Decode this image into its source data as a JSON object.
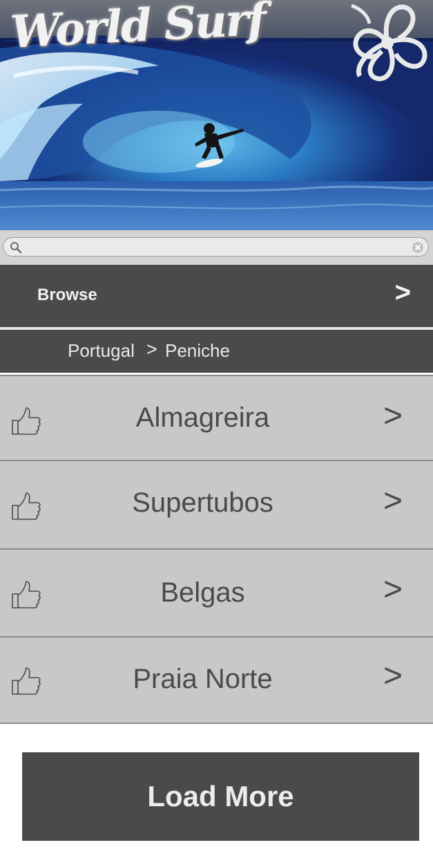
{
  "header": {
    "logo_text": "World Surf",
    "banner_image": "surfer-in-barrel-wave",
    "decoration_icon": "hibiscus-flower-icon"
  },
  "search": {
    "placeholder": "",
    "value": "",
    "search_icon": "search-icon",
    "clear_icon": "clear-icon"
  },
  "browse": {
    "label": "Browse",
    "arrow": ">"
  },
  "breadcrumb": {
    "items": [
      "Portugal",
      "Peniche"
    ],
    "separator": ">"
  },
  "spots": [
    {
      "name": "Almagreira",
      "icon": "thumbs-up-icon",
      "arrow": ">"
    },
    {
      "name": "Supertubos",
      "icon": "thumbs-up-icon",
      "arrow": ">"
    },
    {
      "name": "Belgas",
      "icon": "thumbs-up-icon",
      "arrow": ">"
    },
    {
      "name": "Praia Norte",
      "icon": "thumbs-up-icon",
      "arrow": ">"
    }
  ],
  "load_more": {
    "label": "Load More"
  },
  "colors": {
    "dark_bar": "#4a4a4a",
    "list_bg": "#c8c8c8",
    "list_text": "#4a4a4a",
    "search_bg": "#d4d4d4"
  }
}
